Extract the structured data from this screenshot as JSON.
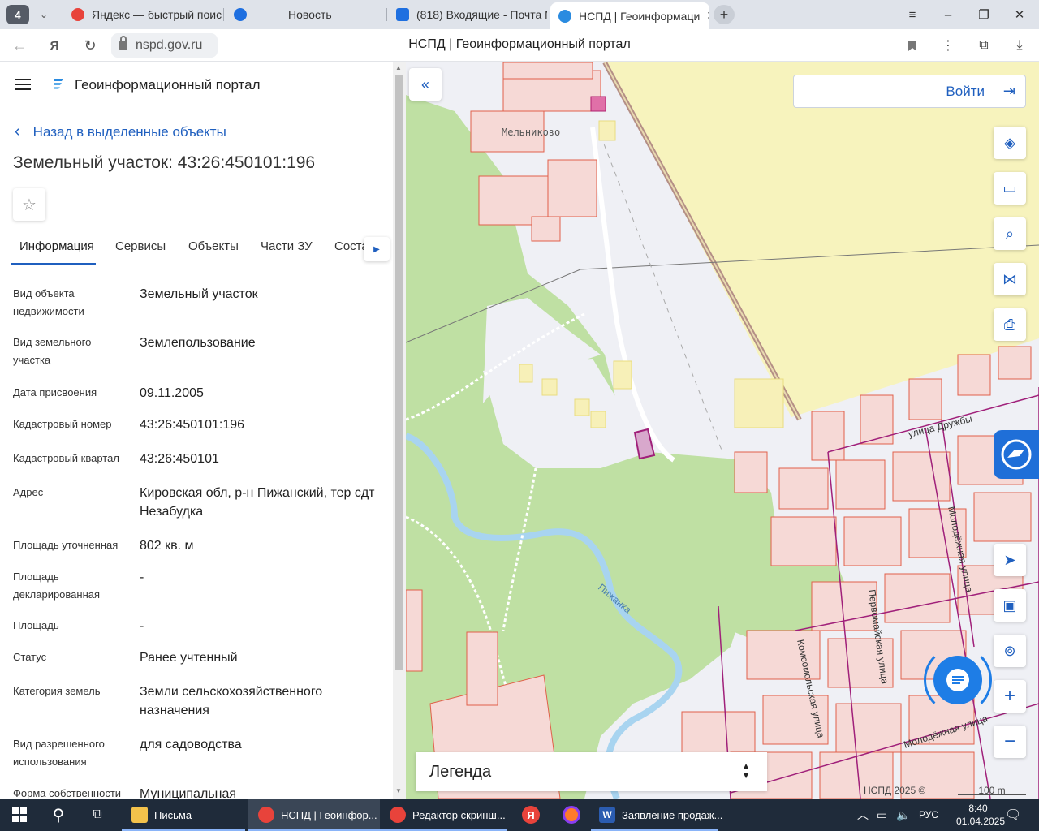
{
  "browser": {
    "tab_count": "4",
    "tabs": [
      {
        "label": "Яндекс — быстрый поиск",
        "favicon_color": "#e8433b"
      },
      {
        "label": "Новость",
        "favicon_color": "#1e6fe0"
      },
      {
        "label": "(818) Входящие - Почта М",
        "favicon_color": "#1e6fe0"
      },
      {
        "label": "НСПД | Геоинформаци",
        "favicon_color": "#2a8be0"
      }
    ],
    "url": "nspd.gov.ru",
    "page_title": "НСПД | Геоинформационный портал"
  },
  "panel": {
    "portal_title": "Геоинформационный портал",
    "back_link": "Назад в выделенные объекты",
    "object_title": "Земельный участок: 43:26:450101:196",
    "tabs": [
      "Информация",
      "Сервисы",
      "Объекты",
      "Части ЗУ",
      "Соста"
    ],
    "info": [
      {
        "label": "Вид объекта недвижимости",
        "value": "Земельный участок"
      },
      {
        "label": "Вид земельного участка",
        "value": "Землепользование"
      },
      {
        "label": "Дата присвоения",
        "value": "09.11.2005"
      },
      {
        "label": "Кадастровый номер",
        "value": "43:26:450101:196"
      },
      {
        "label": "Кадастровый квартал",
        "value": "43:26:450101"
      },
      {
        "label": "Адрес",
        "value": "Кировская обл, р-н Пижанский, тер сдт Незабудка"
      },
      {
        "label": "Площадь уточненная",
        "value": "802 кв. м"
      },
      {
        "label": "Площадь декларированная",
        "value": "-"
      },
      {
        "label": "Площадь",
        "value": "-"
      },
      {
        "label": "Статус",
        "value": "Ранее учтенный"
      },
      {
        "label": "Категория земель",
        "value": "Земли сельскохозяйственного назначения"
      },
      {
        "label": "Вид разрешенного использования",
        "value": "для садоводства"
      },
      {
        "label": "Форма собственности",
        "value": "Муниципальная"
      }
    ]
  },
  "map": {
    "login_label": "Войти",
    "legend_label": "Легенда",
    "copyright": "НСПД 2025 ©",
    "scale": "100 m",
    "labels": {
      "village": "Мельниково",
      "river": "Пижанка",
      "street1": "улица Дружбы",
      "street2": "Молодёжная улица",
      "street3": "Первомайская улица",
      "street4": "Комсомольская улица",
      "street5": "Молодёжная улица"
    },
    "colors": {
      "parcel_stroke": "#e0604a",
      "parcel_fill": "#f6d9d6",
      "selected": "#a0207a",
      "forest": "#bfe0a3",
      "field": "#f7f3bd",
      "river": "#a8d4f0"
    }
  },
  "taskbar": {
    "items": [
      "Письма",
      "НСПД | Геоинфор...",
      "Редактор скринш...",
      "Заявление продаж..."
    ],
    "lang": "РУС",
    "time": "8:40",
    "date": "01.04.2025"
  }
}
